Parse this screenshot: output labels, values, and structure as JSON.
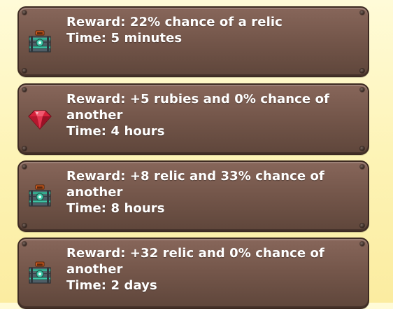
{
  "rewards": [
    {
      "icon": "treasure-chest-icon",
      "reward": "Reward: 22% chance of a relic",
      "time": "Time: 5 minutes"
    },
    {
      "icon": "ruby-icon",
      "reward": "Reward: +5 rubies and 0% chance of another",
      "time": "Time: 4 hours"
    },
    {
      "icon": "treasure-chest-icon",
      "reward": "Reward: +8 relic and 33% chance of another",
      "time": "Time: 8 hours"
    },
    {
      "icon": "treasure-chest-icon",
      "reward": "Reward: +32 relic and 0% chance of another",
      "time": "Time: 2 days"
    }
  ],
  "colors": {
    "card": "#75574b",
    "card_border": "#3d2a22",
    "text": "#ffffff",
    "background": "#fdf3b4",
    "ruby": "#d6213a",
    "chest_body": "#5a6a74",
    "chest_lid": "#e0621e",
    "chest_gem": "#3fc7a8"
  }
}
